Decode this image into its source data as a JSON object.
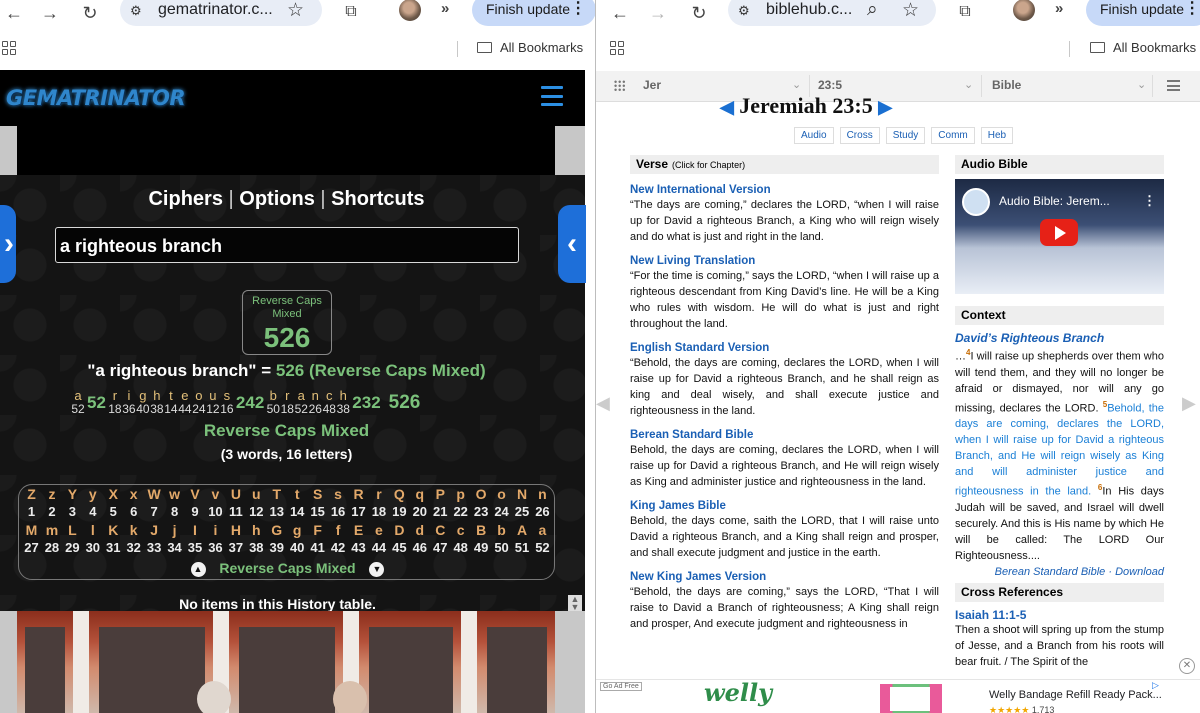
{
  "left_browser": {
    "url": "gematrinator.c...",
    "update_label": "Finish update",
    "bookmarks_label": "All Bookmarks"
  },
  "right_browser": {
    "url": "biblehub.c...",
    "update_label": "Finish update",
    "bookmarks_label": "All Bookmarks"
  },
  "gematrinator": {
    "logo": "GEMATRINATOR",
    "menu": [
      "Ciphers",
      "Options",
      "Shortcuts"
    ],
    "menu_sep": "|",
    "input_value": "a righteous branch",
    "cipher_box_name": "Reverse Caps Mixed",
    "cipher_box_value": "526",
    "result_phrase": "\"a righteous branch\" =",
    "result_value": "526 (Reverse Caps Mixed)",
    "breakdown": [
      {
        "letters": [
          "a"
        ],
        "values": [
          "52"
        ],
        "sum": "52"
      },
      {
        "letters": [
          "r",
          "i",
          "g",
          "h",
          "t",
          "e",
          "o",
          "u",
          "s"
        ],
        "values": [
          "18",
          "36",
          "40",
          "38",
          "14",
          "44",
          "24",
          "12",
          "16"
        ],
        "sum": "242"
      },
      {
        "letters": [
          "b",
          "r",
          "a",
          "n",
          "c",
          "h"
        ],
        "values": [
          "50",
          "18",
          "52",
          "26",
          "48",
          "38"
        ],
        "sum": "232"
      }
    ],
    "breakdown_total": "526",
    "cipher_name": "Reverse Caps Mixed",
    "counts": "(3 words, 16 letters)",
    "chart_letters_1": [
      "Z",
      "z",
      "Y",
      "y",
      "X",
      "x",
      "W",
      "w",
      "V",
      "v",
      "U",
      "u",
      "T",
      "t",
      "S",
      "s",
      "R",
      "r",
      "Q",
      "q",
      "P",
      "p",
      "O",
      "o",
      "N",
      "n"
    ],
    "chart_numbers_1": [
      "1",
      "2",
      "3",
      "4",
      "5",
      "6",
      "7",
      "8",
      "9",
      "10",
      "11",
      "12",
      "13",
      "14",
      "15",
      "16",
      "17",
      "18",
      "19",
      "20",
      "21",
      "22",
      "23",
      "24",
      "25",
      "26"
    ],
    "chart_letters_2": [
      "M",
      "m",
      "L",
      "l",
      "K",
      "k",
      "J",
      "j",
      "I",
      "i",
      "H",
      "h",
      "G",
      "g",
      "F",
      "f",
      "E",
      "e",
      "D",
      "d",
      "C",
      "c",
      "B",
      "b",
      "A",
      "a"
    ],
    "chart_numbers_2": [
      "27",
      "28",
      "29",
      "30",
      "31",
      "32",
      "33",
      "34",
      "35",
      "36",
      "37",
      "38",
      "39",
      "40",
      "41",
      "42",
      "43",
      "44",
      "45",
      "46",
      "47",
      "48",
      "49",
      "50",
      "51",
      "52"
    ],
    "chart_footer": "Reverse Caps Mixed",
    "history_text": "No items in this History table."
  },
  "biblehub": {
    "nav_book": "Jer",
    "nav_verse": "23:5",
    "nav_version": "Bible",
    "title": "Jeremiah 23:5",
    "tabs": [
      "Audio",
      "Cross",
      "Study",
      "Comm",
      "Heb"
    ],
    "verse_header": "Verse",
    "verse_header_note": "(Click for Chapter)",
    "versions": [
      {
        "name": "New International Version",
        "text": "“The days are coming,” declares the LORD, “when I will raise up for David a righteous Branch, a King who will reign wisely and do what is just and right in the land."
      },
      {
        "name": "New Living Translation",
        "text": "“For the time is coming,” says the LORD, “when I will raise up a righteous descendant from King David’s line. He will be a King who rules with wisdom. He will do what is just and right throughout the land."
      },
      {
        "name": "English Standard Version",
        "text": "“Behold, the days are coming, declares the LORD, when I will raise up for David a righteous Branch, and he shall reign as king and deal wisely, and shall execute justice and righteousness in the land."
      },
      {
        "name": "Berean Standard Bible",
        "text": "Behold, the days are coming, declares the LORD, when I will raise up for David a righteous Branch, and He will reign wisely as King and administer justice and righteousness in the land."
      },
      {
        "name": "King James Bible",
        "text": "Behold, the days come, saith the LORD, that I will raise unto David a righteous Branch, and a King shall reign and prosper, and shall execute judgment and justice in the earth."
      },
      {
        "name": "New King James Version",
        "text": "“Behold, the days are coming,” says the LORD, “That I will raise to David a Branch of righteousness; A King shall reign and prosper, And execute judgment and righteousness in"
      }
    ],
    "audio_header": "Audio Bible",
    "video_title": "Audio Bible: Jerem...",
    "context_header": "Context",
    "context_title": "David’s Righteous Branch",
    "context_v4_num": "4",
    "context_v4": "I will raise up shepherds over them who will tend them, and they will no longer be afraid or dismayed, nor will any go missing, declares the LORD.",
    "context_v5_num": "5",
    "context_v5": "Behold, the days are coming, declares the LORD, when I will raise up for David a righteous Branch, and He will reign wisely as King and will administer justice and righteousness in the land.",
    "context_v6_num": "6",
    "context_v6": "In His days Judah will be saved, and Israel will dwell securely. And this is His name by which He will be called: The LORD Our Righteousness....",
    "context_source": "Berean Standard Bible · Download",
    "xref_header": "Cross References",
    "xref_title": "Isaiah 11:1-5",
    "xref_text": "Then a shoot will spring up from the stump of Jesse, and a Branch from his roots will bear fruit. / The Spirit of the"
  },
  "ad": {
    "go_ad_free": "Go Ad Free",
    "brand": "welly",
    "product": "Welly Bandage Refill Ready Pack...",
    "rating_count": "1,713"
  }
}
